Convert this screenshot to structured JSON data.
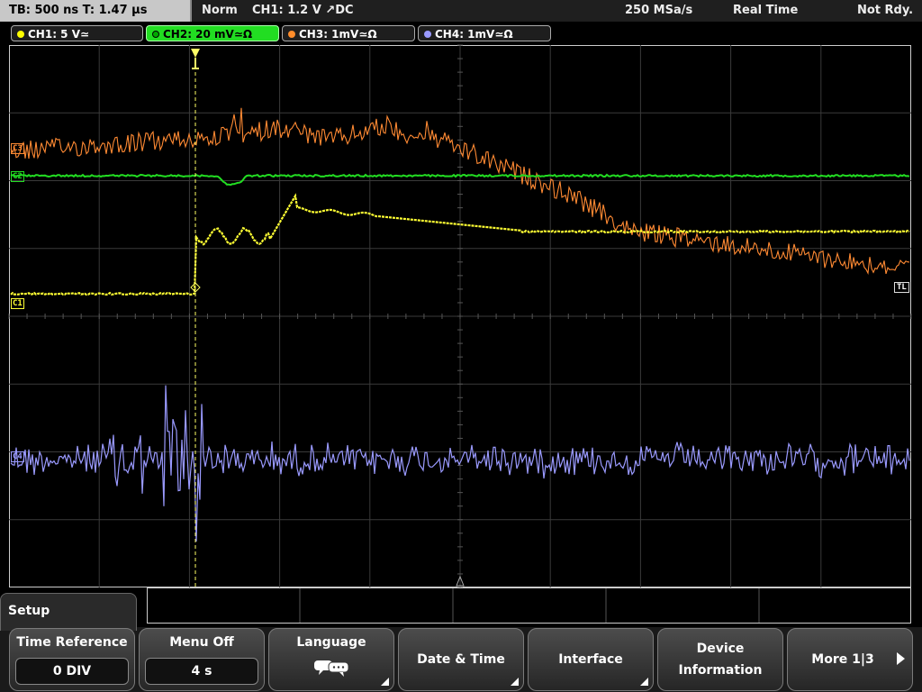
{
  "status": {
    "timebase": "TB: 500 ns  T: 1.47 µs",
    "mode": "Norm",
    "trigger": "CH1: 1.2 V ↗DC",
    "sample_rate": "250 MSa/s",
    "acq_mode": "Real Time",
    "state": "Not Rdy."
  },
  "channels": [
    {
      "label": "CH1: 5 V≃",
      "color": "#ffff00",
      "bg": "#1e1e1e",
      "fg": "#ffffff",
      "active": false
    },
    {
      "label": "CH2: 20 mV≃Ω",
      "color": "#00c800",
      "bg": "#22dd22",
      "fg": "#000000",
      "active": true
    },
    {
      "label": "CH3: 1mV≃Ω",
      "color": "#ff8c2a",
      "bg": "#1e1e1e",
      "fg": "#ffffff",
      "active": false
    },
    {
      "label": "CH4: 1mV≃Ω",
      "color": "#9a9aff",
      "bg": "#1e1e1e",
      "fg": "#ffffff",
      "active": false
    }
  ],
  "trace_labels": {
    "c3": "C3",
    "c2": "C2",
    "c1": "C1",
    "c4": "C4",
    "tl": "TL"
  },
  "trace_colors": {
    "ch1": "#ffff33",
    "ch2": "#22dd22",
    "ch3": "#ff8a33",
    "ch4": "#9a9aff",
    "trigger_line": "#ffff66"
  },
  "menu": {
    "title": "Setup",
    "softkeys": [
      {
        "label": "Time Reference",
        "value": "0 DIV"
      },
      {
        "label": "Menu Off",
        "value": "4 s"
      },
      {
        "label": "Language",
        "icon": "speech-bubbles-icon"
      },
      {
        "label": "Date & Time"
      },
      {
        "label": "Interface"
      },
      {
        "label": "Device\nInformation",
        "line1": "Device",
        "line2": "Information"
      },
      {
        "label": "More 1|3"
      }
    ]
  }
}
